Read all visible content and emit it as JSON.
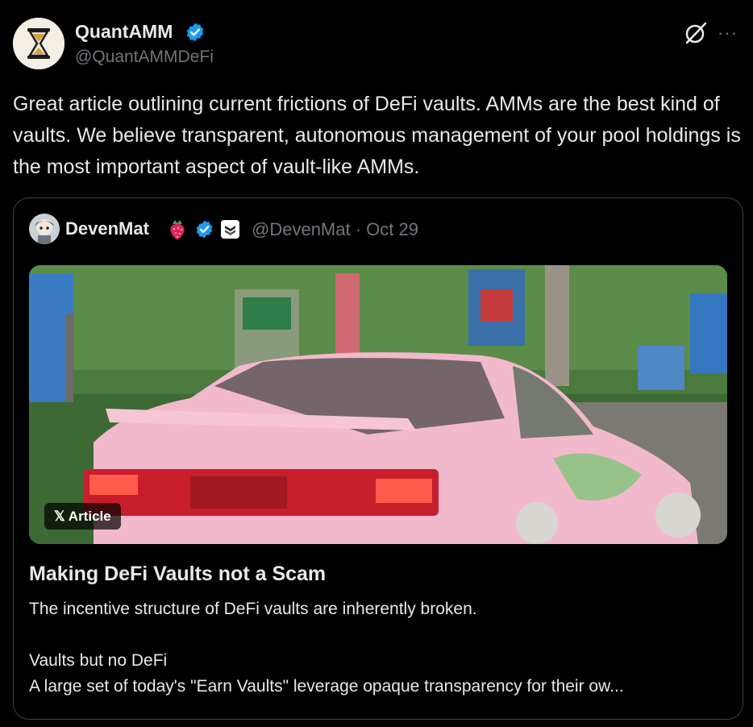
{
  "author": {
    "name": "QuantAMM",
    "handle": "@QuantAMMDeFi",
    "avatar_icon": "hourglass-logo-icon",
    "verified_color": "#1d9bf0"
  },
  "header_actions": {
    "grok_icon": "grok-icon",
    "more_label": "···"
  },
  "tweet": {
    "text": "Great article outlining current frictions of DeFi vaults. AMMs are the best kind of vaults. We believe transparent, autonomous management of your pool holdings is the most important aspect of vault-like AMMs."
  },
  "quoted": {
    "name": "DevenMat",
    "emoji_icon": "strawberry-icon",
    "handle_time": "@DevenMat · Oct 29",
    "badge_label": "𝕏 Article",
    "title": "Making DeFi Vaults not a Scam",
    "desc_line1": "The incentive structure of DeFi vaults are inherently broken.",
    "desc_line2": "Vaults but no DeFi",
    "desc_line3": "A large set of today's \"Earn Vaults\" leverage opaque transparency for their ow..."
  }
}
